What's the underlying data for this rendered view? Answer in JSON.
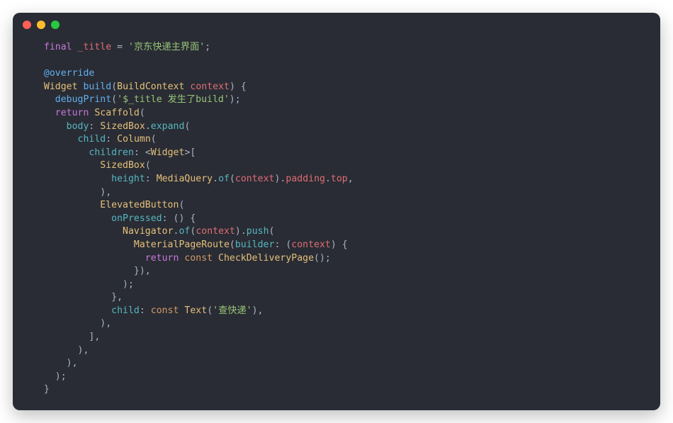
{
  "code": {
    "line1": {
      "kw1": "final",
      "id": "_title",
      "eq": "=",
      "str": "'京东快递主界面'",
      "semi": ";"
    },
    "line2": {
      "ann": "@override"
    },
    "line3": {
      "typ": "Widget",
      "fn": "build",
      "lp": "(",
      "argtyp": "BuildContext",
      "argname": "context",
      "rp": ") {"
    },
    "line4": {
      "fn": "debugPrint",
      "lp": "(",
      "str": "'$_title 发生了build'",
      "rp": ")",
      "semi": ";"
    },
    "line5": {
      "kw": "return",
      "typ": "Scaffold",
      "lp": "("
    },
    "line6": {
      "prop": "body",
      "colon": ":",
      "typ": "SizedBox",
      "dot": ".",
      "met": "expand",
      "lp": "("
    },
    "line7": {
      "prop": "child",
      "colon": ":",
      "typ": "Column",
      "lp": "("
    },
    "line8": {
      "prop": "children",
      "colon": ":",
      "lt": "<",
      "typ": "Widget",
      "gt": ">["
    },
    "line9": {
      "typ": "SizedBox",
      "lp": "("
    },
    "line10": {
      "prop": "height",
      "colon": ":",
      "typ": "MediaQuery",
      "dot1": ".",
      "met1": "of",
      "lp": "(",
      "arg": "context",
      "rp": ").",
      "field1": "padding",
      "dot2": ".",
      "field2": "top",
      "comma": ","
    },
    "line11": {
      "rp": "),"
    },
    "line12": {
      "typ": "ElevatedButton",
      "lp": "("
    },
    "line13": {
      "prop": "onPressed",
      "colon": ": () {"
    },
    "line14": {
      "typ": "Navigator",
      "dot": ".",
      "met": "of",
      "lp": "(",
      "arg": "context",
      "rp": ").",
      "met2": "push",
      "lp2": "("
    },
    "line15": {
      "typ": "MaterialPageRoute",
      "lp": "(",
      "prop": "builder",
      "colon": ": (",
      "arg": "context",
      "rp": ") {"
    },
    "line16": {
      "kw": "return",
      "lit": "const",
      "typ": "CheckDeliveryPage",
      "lp": "()",
      "semi": ";"
    },
    "line17": {
      "txt": "}),"
    },
    "line18": {
      "txt": ")",
      "semi": ";"
    },
    "line19": {
      "txt": "}",
      "comma": ","
    },
    "line20": {
      "prop": "child",
      "colon": ":",
      "lit": "const",
      "typ": "Text",
      "lp": "(",
      "str": "'查快递'",
      "rp": "),"
    },
    "line21": {
      "txt": "),"
    },
    "line22": {
      "txt": "],"
    },
    "line23": {
      "txt": "),"
    },
    "line24": {
      "txt": "),"
    },
    "line25": {
      "txt": ")",
      "semi": ";"
    },
    "line26": {
      "txt": "}"
    }
  }
}
